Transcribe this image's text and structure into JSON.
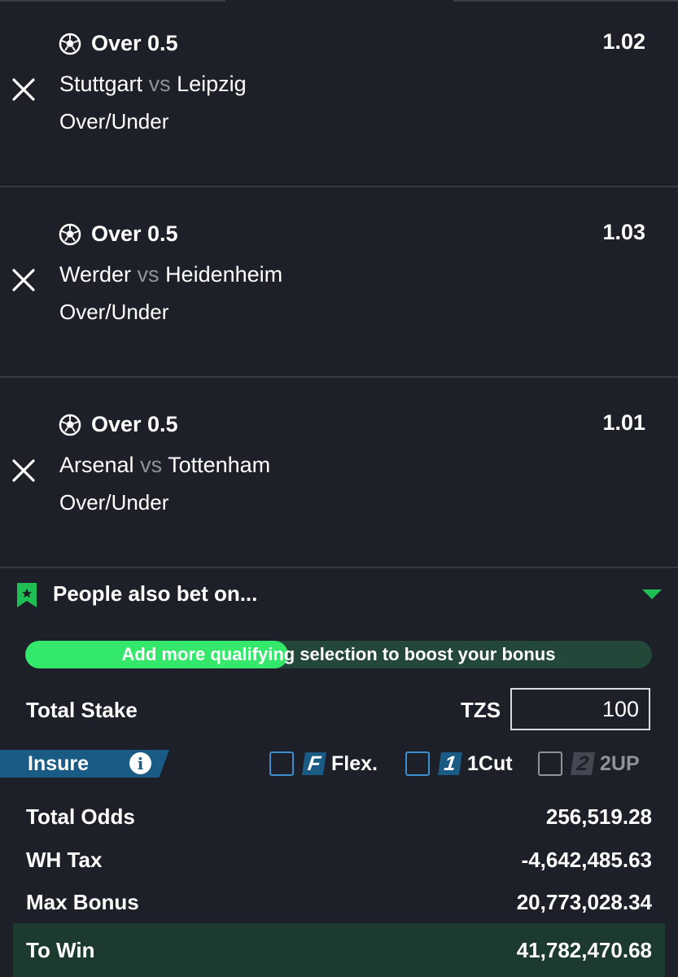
{
  "bets": [
    {
      "market": "Over 0.5",
      "odds": "1.02",
      "home": "Stuttgart",
      "vs": "vs",
      "away": "Leipzig",
      "type": "Over/Under"
    },
    {
      "market": "Over 0.5",
      "odds": "1.03",
      "home": "Werder",
      "vs": "vs",
      "away": "Heidenheim",
      "type": "Over/Under"
    },
    {
      "market": "Over 0.5",
      "odds": "1.01",
      "home": "Arsenal",
      "vs": "vs",
      "away": "Tottenham",
      "type": "Over/Under"
    }
  ],
  "also_bet": {
    "label": "People also bet on..."
  },
  "bonus_progress": {
    "text": "Add more qualifying selection to boost your bonus",
    "fraction": 0.42
  },
  "stake": {
    "label": "Total Stake",
    "currency": "TZS",
    "value": "100"
  },
  "insure": {
    "label": "Insure",
    "info": "i"
  },
  "options": {
    "flex": {
      "badge": "F",
      "label": "Flex."
    },
    "onecut": {
      "badge": "1",
      "label": "1Cut"
    },
    "twoup": {
      "badge": "2",
      "label": "2UP"
    }
  },
  "summary": {
    "total_odds_label": "Total Odds",
    "total_odds": "256,519.28",
    "wh_tax_label": "WH Tax",
    "wh_tax": "-4,642,485.63",
    "max_bonus_label": "Max Bonus",
    "max_bonus": "20,773,028.34",
    "to_win_label": "To Win",
    "to_win": "41,782,470.68"
  },
  "colors": {
    "accent_green": "#33e86b",
    "insure_blue": "#1a5b86",
    "background": "#1d2028"
  }
}
